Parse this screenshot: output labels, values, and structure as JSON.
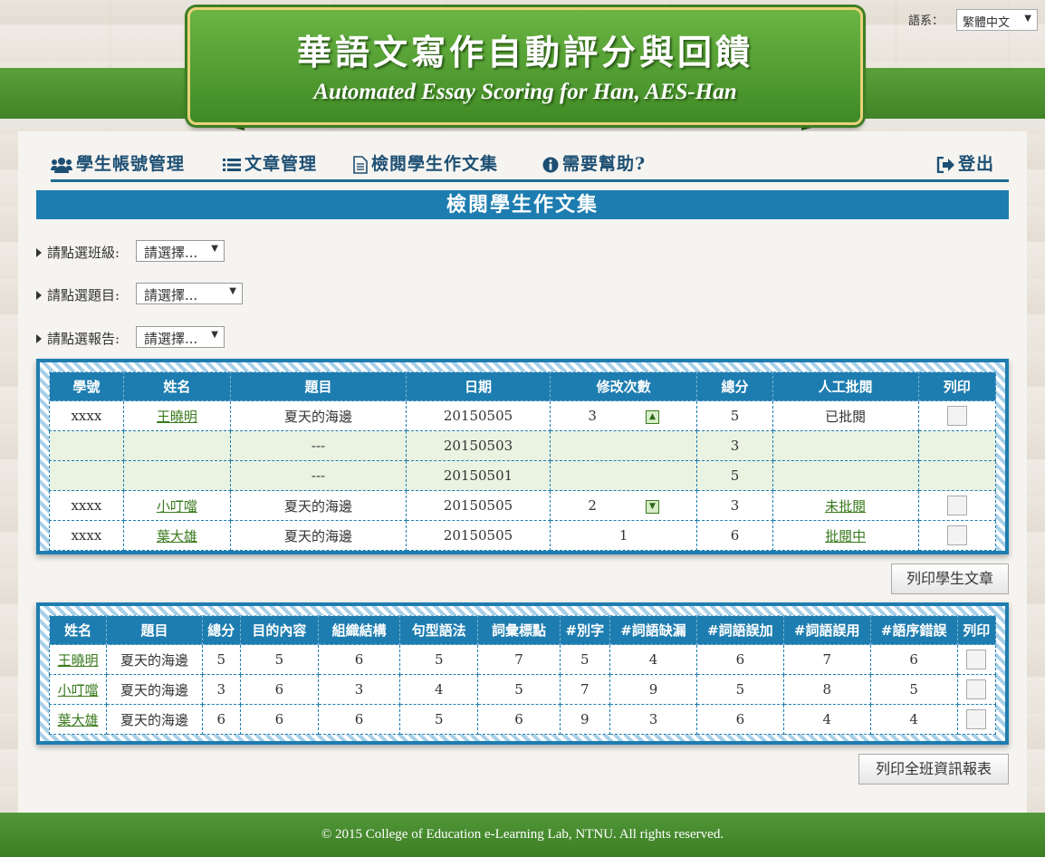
{
  "banner": {
    "title": "華語文寫作自動評分與回饋",
    "subtitle": "Automated Essay Scoring for Han, AES-Han"
  },
  "language": {
    "label": "語系：",
    "selected": "繁體中文"
  },
  "nav": {
    "student_accounts": "學生帳號管理",
    "article_management": "文章管理",
    "review_essays": "檢閱學生作文集",
    "help": "需要幫助?",
    "logout": "登出"
  },
  "page_title": "檢閱學生作文集",
  "filters": {
    "class_label": "請點選班級:",
    "class_value": "請選擇...",
    "topic_label": "請點選題目:",
    "topic_value": "請選擇...",
    "report_label": "請點選報告:",
    "report_value": "請選擇..."
  },
  "table1": {
    "headers": [
      "學號",
      "姓名",
      "題目",
      "日期",
      "修改次數",
      "總分",
      "人工批閱",
      "列印"
    ],
    "rows": [
      {
        "id": "xxxx",
        "name": "王曉明",
        "topic": "夏天的海邊",
        "date": "20150505",
        "revisions": "3",
        "sort_icon": "expand-up-icon",
        "score": "5",
        "review": "已批閱",
        "review_link": false,
        "print": true,
        "sub": false
      },
      {
        "id": "",
        "name": "",
        "topic": "---",
        "date": "20150503",
        "revisions": "",
        "sort_icon": "",
        "score": "3",
        "review": "",
        "review_link": false,
        "print": false,
        "sub": true
      },
      {
        "id": "",
        "name": "",
        "topic": "---",
        "date": "20150501",
        "revisions": "",
        "sort_icon": "",
        "score": "5",
        "review": "",
        "review_link": false,
        "print": false,
        "sub": true
      },
      {
        "id": "xxxx",
        "name": "小叮噹",
        "topic": "夏天的海邊",
        "date": "20150505",
        "revisions": "2",
        "sort_icon": "expand-down-icon",
        "score": "3",
        "review": "未批閱",
        "review_link": true,
        "print": true,
        "sub": false
      },
      {
        "id": "xxxx",
        "name": "葉大雄",
        "topic": "夏天的海邊",
        "date": "20150505",
        "revisions": "1",
        "sort_icon": "",
        "score": "6",
        "review": "批閱中",
        "review_link": true,
        "print": true,
        "sub": false
      }
    ]
  },
  "print_student_button": "列印學生文章",
  "table2": {
    "headers": [
      "姓名",
      "題目",
      "總分",
      "目的內容",
      "組織結構",
      "句型語法",
      "詞彙標點",
      "#別字",
      "#詞語缺漏",
      "#詞語誤加",
      "#詞語誤用",
      "#語序錯誤",
      "列印"
    ],
    "rows": [
      {
        "name": "王曉明",
        "topic": "夏天的海邊",
        "values": [
          "5",
          "5",
          "6",
          "5",
          "7",
          "5",
          "4",
          "6",
          "7",
          "6"
        ]
      },
      {
        "name": "小叮噹",
        "topic": "夏天的海邊",
        "values": [
          "3",
          "6",
          "3",
          "4",
          "5",
          "7",
          "9",
          "5",
          "8",
          "5"
        ]
      },
      {
        "name": "葉大雄",
        "topic": "夏天的海邊",
        "values": [
          "6",
          "6",
          "6",
          "5",
          "6",
          "9",
          "3",
          "6",
          "4",
          "4"
        ]
      }
    ]
  },
  "print_class_button": "列印全班資訊報表",
  "footer": "© 2015 College of Education e-Learning Lab, NTNU. All rights reserved."
}
